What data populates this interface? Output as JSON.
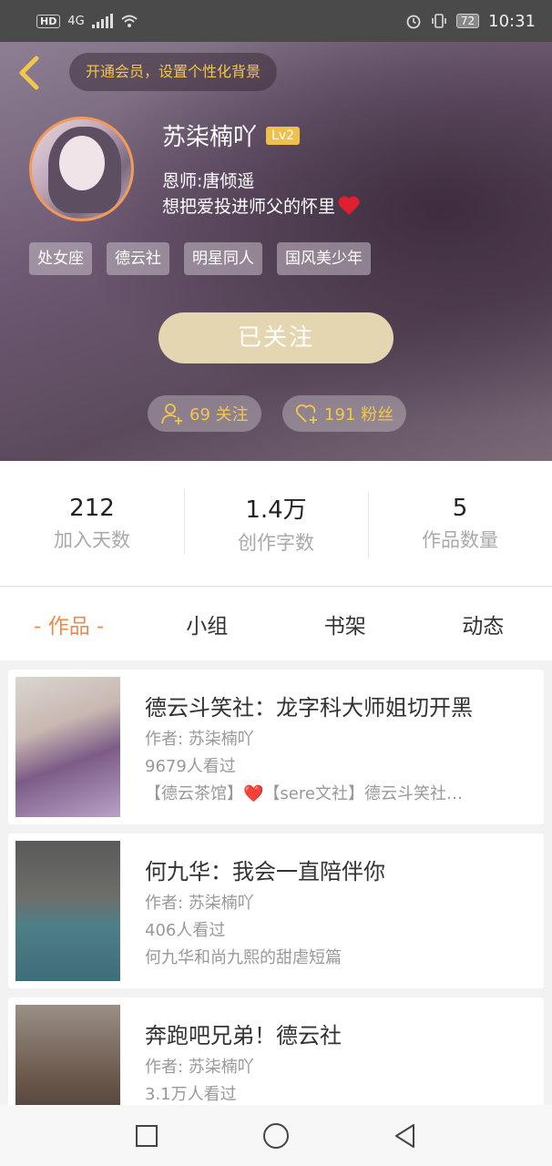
{
  "status_bar": {
    "network": "4G",
    "battery": "72",
    "time": "10:31"
  },
  "header": {
    "vip_prompt": "开通会员，设置个性化背景",
    "username": "苏柒楠吖",
    "level": "Lv2",
    "mentor": "恩师:唐倾遥",
    "signature": "想把爱投进师父的怀里",
    "tags": [
      "处女座",
      "德云社",
      "明星同人",
      "国风美少年"
    ],
    "follow_button": "已关注",
    "following": "69 关注",
    "fans": "191 粉丝"
  },
  "stats": [
    {
      "value": "212",
      "label": "加入天数"
    },
    {
      "value": "1.4万",
      "label": "创作字数"
    },
    {
      "value": "5",
      "label": "作品数量"
    }
  ],
  "tabs": [
    "- 作品 -",
    "小组",
    "书架",
    "动态"
  ],
  "works": [
    {
      "title": "德云斗笑社：龙字科大师姐切开黑",
      "author": "作者: 苏柒楠吖",
      "views": "9679人看过",
      "desc": "【德云茶馆】❤️【sere文社】德云斗笑社…"
    },
    {
      "title": "何九华：我会一直陪伴你",
      "author": "作者: 苏柒楠吖",
      "views": "406人看过",
      "desc": "何九华和尚九熙的甜虐短篇"
    },
    {
      "title": "奔跑吧兄弟！德云社",
      "author": "作者: 苏柒楠吖",
      "views": "3.1万人看过",
      "desc": ""
    }
  ],
  "colors": {
    "accent": "#f08a4c",
    "gold": "#f3c74b",
    "follow_bg": "#e3d6b0"
  }
}
